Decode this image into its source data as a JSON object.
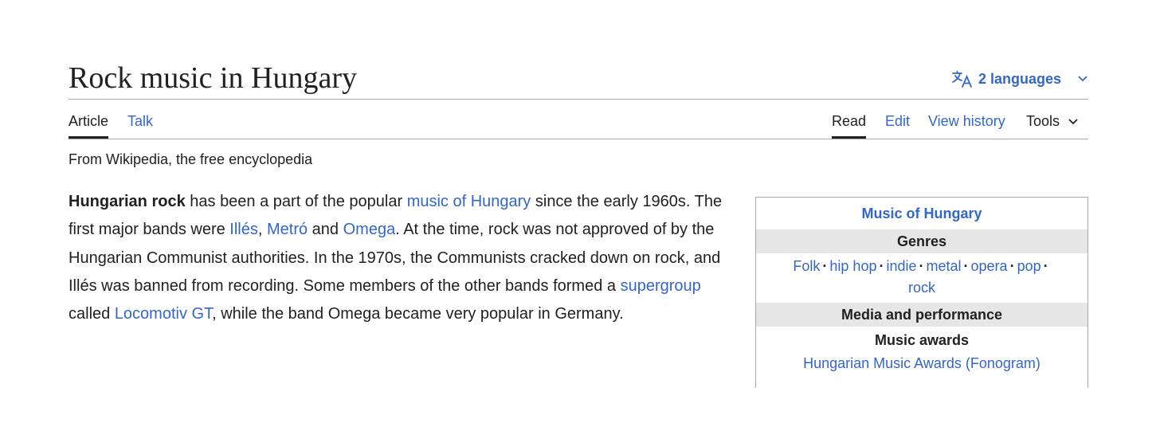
{
  "page": {
    "title": "Rock music in Hungary",
    "languages_label": "2 languages"
  },
  "tabs": {
    "article": "Article",
    "talk": "Talk",
    "read": "Read",
    "edit": "Edit",
    "view_history": "View history",
    "tools": "Tools"
  },
  "tagline": "From Wikipedia, the free encyclopedia",
  "article": {
    "bold_lead": "Hungarian rock",
    "t1": " has been a part of the popular ",
    "l1": "music of Hungary",
    "t2": " since the early 1960s. The first major bands were ",
    "l2": "Illés",
    "t3": ", ",
    "l3": "Metró",
    "t4": " and ",
    "l4": "Omega",
    "t5": ". At the time, rock was not approved of by the Hungarian Communist authorities. In the 1970s, the Communists cracked down on rock, and Illés was banned from recording. Some members of the other bands formed a ",
    "l5": "supergroup",
    "t6": " called ",
    "l6": "Locomotiv GT",
    "t7": ", while the band Omega became very popular in Germany."
  },
  "infobox": {
    "title": "Music of Hungary",
    "genres_header": "Genres",
    "genres": [
      "Folk",
      "hip hop",
      "indie",
      "metal",
      "opera",
      "pop",
      "rock"
    ],
    "separator": "·",
    "media_header": "Media and performance",
    "awards_subheader": "Music awards",
    "awards_item": "Hungarian Music Awards (Fonogram)"
  },
  "colors": {
    "link": "#3366cc",
    "text": "#202122",
    "border": "#a2a9b1",
    "header_bg": "#e6e6e6"
  },
  "icons": {
    "language": "translate-icon",
    "chevron": "chevron-down-icon"
  }
}
